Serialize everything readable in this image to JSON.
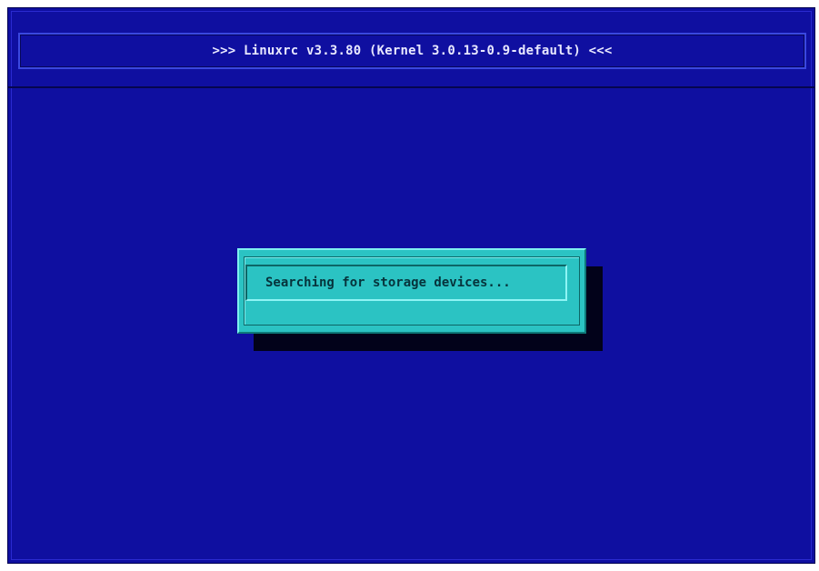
{
  "header": {
    "title": ">>> Linuxrc v3.3.80 (Kernel 3.0.13-0.9-default) <<<"
  },
  "dialog": {
    "message": "Searching for storage devices..."
  },
  "colors": {
    "background": "#0f0fa0",
    "dialog": "#2bc3c3",
    "header_text": "#e8e8ff",
    "dialog_text": "#06333b"
  }
}
